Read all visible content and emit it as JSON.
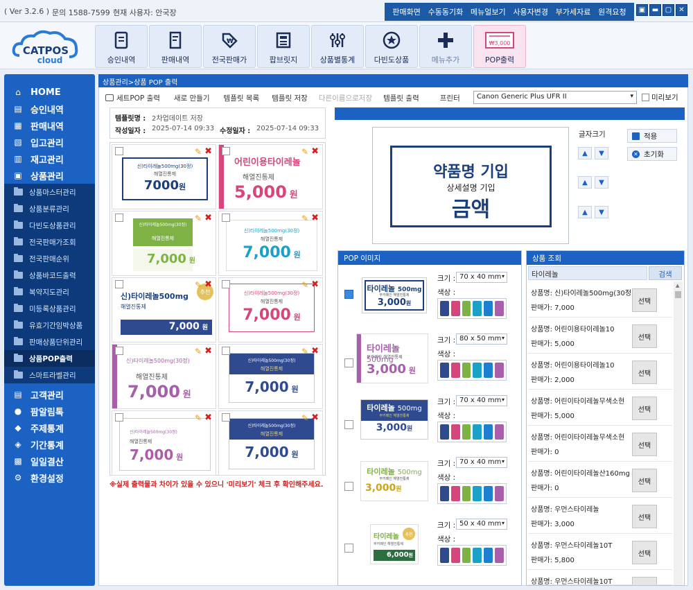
{
  "topbar": {
    "version": "( Ver 3.2.6 )",
    "inquiry": "문의 1588-7599",
    "user": "현재 사용자: 안국장",
    "nav": [
      "판매화면",
      "수동동기화",
      "메뉴얼보기",
      "사용자변경",
      "부가세자료",
      "원격요청"
    ],
    "window_controls": [
      "▣",
      "▬",
      "▢",
      "✕"
    ]
  },
  "logo": {
    "line1": "CATPOS",
    "line2": "cloud"
  },
  "header_buttons": [
    {
      "label": "승인내역",
      "icon": "receipt-icon"
    },
    {
      "label": "판매내역",
      "icon": "document-icon"
    },
    {
      "label": "전국판매가",
      "icon": "price-tag-icon"
    },
    {
      "label": "팝브릿지",
      "icon": "bridge-icon"
    },
    {
      "label": "상품별통계",
      "icon": "sliders-icon"
    },
    {
      "label": "다빈도상품",
      "icon": "star-icon"
    },
    {
      "label": "메뉴추가",
      "icon": "plus-icon"
    },
    {
      "label": "POP출력",
      "icon": "pop-print-icon",
      "sub": "₩3,000"
    }
  ],
  "sidebar": {
    "main": [
      {
        "label": "HOME",
        "icon": "home-icon"
      },
      {
        "label": "승인내역",
        "icon": "receipt-icon"
      },
      {
        "label": "판매내역",
        "icon": "document-icon"
      },
      {
        "label": "입고관리",
        "icon": "inbox-icon"
      },
      {
        "label": "재고관리",
        "icon": "stock-icon"
      },
      {
        "label": "상품관리",
        "icon": "product-icon"
      }
    ],
    "sub": [
      "상품마스터관리",
      "상품분류관리",
      "다빈도상품관리",
      "전국판매가조회",
      "전국판매순위",
      "상품바코드출력",
      "복약지도관리",
      "미등록상품관리",
      "유효기간임박상품",
      "판매상품단위관리",
      "상품POP출력",
      "스마트라벨관리"
    ],
    "active_sub": "상품POP출력",
    "bottom": [
      {
        "label": "고객관리",
        "icon": "customer-icon"
      },
      {
        "label": "팜알림톡",
        "icon": "chat-icon"
      },
      {
        "label": "주제통계",
        "icon": "chart-icon"
      },
      {
        "label": "기간통계",
        "icon": "calendar-icon"
      },
      {
        "label": "일일결산",
        "icon": "settlement-icon"
      },
      {
        "label": "환경설정",
        "icon": "gear-icon"
      }
    ]
  },
  "breadcrumb": "상품관리>상품 POP 출력",
  "toolbar": {
    "items": [
      "세트POP 출력",
      "새로 만들기",
      "템플릿 목록",
      "템플릿 저장",
      "다른이름으로저장",
      "템플릿 출력",
      "프린터"
    ],
    "printer": "Canon Generic Plus UFR II",
    "preview": "미리보기"
  },
  "template_info": {
    "name_label": "템플릿명 :",
    "name": "2차업데이트 저장",
    "created_label": "작성일자 :",
    "created": "2025-07-14 09:33",
    "modified_label": "수정일자 :",
    "modified": "2025-07-14 09:33"
  },
  "templates": [
    {
      "small": "신)타이레놀500mg(30정)",
      "sub": "해열진통제",
      "price": "7000",
      "unit": "원"
    },
    {
      "small": "어린이용타이레놀",
      "sub": "해열진통제",
      "price": "5,000",
      "unit": "원"
    },
    {
      "small": "신)타이레놀500mg(30정)",
      "sub": "해열진통제",
      "price": "7,000",
      "unit": "원"
    },
    {
      "small": "신)타이레놀500mg(30정)",
      "sub": "해열진통제",
      "price": "7,000",
      "unit": "원"
    },
    {
      "small": "신)타이레놀500mg",
      "sub": "해열진통제",
      "price": "7,000",
      "unit": "원",
      "badge": "추천"
    },
    {
      "small": "신)타이레놀500mg(30정)",
      "sub": "해열진통제",
      "price": "7,000",
      "unit": "원"
    },
    {
      "small": "신)타이레놀500mg(30정)",
      "sub": "해열진통제",
      "price": "7,000",
      "unit": "원"
    },
    {
      "small": "신)타이레놀500mg(30정)",
      "sub": "해열진통제",
      "price": "7,000",
      "unit": "원"
    },
    {
      "small": "신)타이레놀500mg(30정)",
      "sub": "해열진통제",
      "price": "7,000",
      "unit": "원"
    },
    {
      "small": "신)타이레놀500mg(30정)",
      "sub": "해열진통제",
      "price": "7,000",
      "unit": "원"
    }
  ],
  "warning": "※실제 출력물과 차이가 있을 수 있으니 '미리보기' 체크 후 확인해주세요.",
  "preview": {
    "name": "약품명 기입",
    "detail": "상세설명 기입",
    "price": "금액",
    "font_size_label": "글자크기",
    "apply": "적용",
    "reset": "초기화"
  },
  "pop_image": {
    "title": "POP 이미지",
    "size_label": "크기 :",
    "color_label": "색상 :",
    "rows": [
      {
        "name": "타이레놀",
        "spec": "500mg",
        "desc": "무카페인 해열진통제",
        "price": "3,000",
        "unit": "원",
        "size": "70 x 40 mm",
        "checked": true
      },
      {
        "name": "타이레놀",
        "spec": "500mg",
        "desc": "무카페인 해열진통제",
        "price": "3,000",
        "unit": "원",
        "size": "80 x 50 mm",
        "checked": false
      },
      {
        "name": "타이레놀",
        "spec": "500mg",
        "desc": "무카페인 해열진통제",
        "price": "3,000",
        "unit": "원",
        "size": "70 x 40 mm",
        "checked": false
      },
      {
        "name": "타이레놀",
        "spec": "500mg",
        "desc": "무카페인 해열진통제",
        "price": "3,000",
        "unit": "원",
        "size": "70 x 40 mm",
        "checked": false
      },
      {
        "name": "타이레놀",
        "spec": "",
        "desc": "무카페인 해열진통제",
        "price": "6,000",
        "unit": "원",
        "size": "50 x 40 mm",
        "checked": false,
        "badge": "추천"
      }
    ],
    "swatches": [
      "#2f4a8f",
      "#d6457c",
      "#7fb244",
      "#1ba0c8",
      "#1c7fd0",
      "#a65fa8"
    ]
  },
  "search": {
    "title": "상품 조회",
    "query": "타이레놀",
    "button": "검색",
    "name_label": "상품명:",
    "price_label": "판매가:",
    "select": "선택",
    "results": [
      {
        "name": "신)타이레놀500mg(30정",
        "price": "7,000"
      },
      {
        "name": "어린이용타이레놀10",
        "price": "5,000"
      },
      {
        "name": "어린이용타이레놀10",
        "price": "2,000"
      },
      {
        "name": "어린이타이레놀무색소현",
        "price": "5,000"
      },
      {
        "name": "어린이타이레놀무색소현",
        "price": "0"
      },
      {
        "name": "어린이타이레놀산160mg",
        "price": "0"
      },
      {
        "name": "우먼스타이레놀",
        "price": "3,000"
      },
      {
        "name": "우먼스타이레놀10T",
        "price": "5,800"
      },
      {
        "name": "우먼스타이레놀10T",
        "price": ""
      }
    ]
  }
}
